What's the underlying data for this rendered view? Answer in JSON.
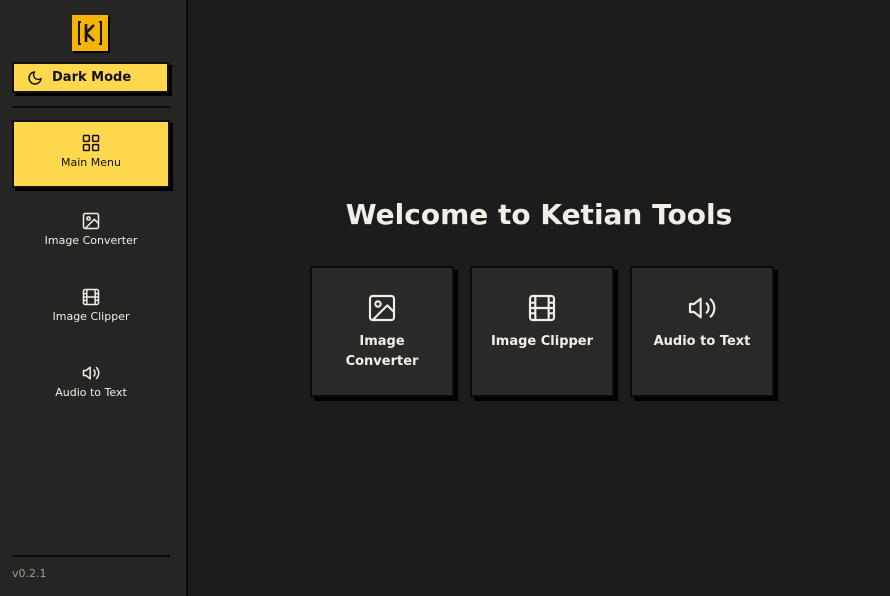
{
  "sidebar": {
    "theme_button_label": "Dark Mode",
    "nav": [
      {
        "label": "Main Menu",
        "icon": "grid-icon",
        "active": true
      },
      {
        "label": "Image Converter",
        "icon": "image-icon",
        "active": false
      },
      {
        "label": "Image Clipper",
        "icon": "film-icon",
        "active": false
      },
      {
        "label": "Audio to Text",
        "icon": "speaker-icon",
        "active": false
      }
    ],
    "version": "v0.2.1"
  },
  "main": {
    "title": "Welcome to Ketian Tools",
    "cards": [
      {
        "label": "Image Converter",
        "icon": "image-icon"
      },
      {
        "label": "Image Clipper",
        "icon": "film-icon"
      },
      {
        "label": "Audio to Text",
        "icon": "speaker-icon"
      }
    ]
  },
  "colors": {
    "accent": "#ffd84d",
    "logo": "#f5b400",
    "background": "#1e1c1b",
    "sidebar": "#272524",
    "card": "#2b2927",
    "text": "#f2ede6"
  }
}
